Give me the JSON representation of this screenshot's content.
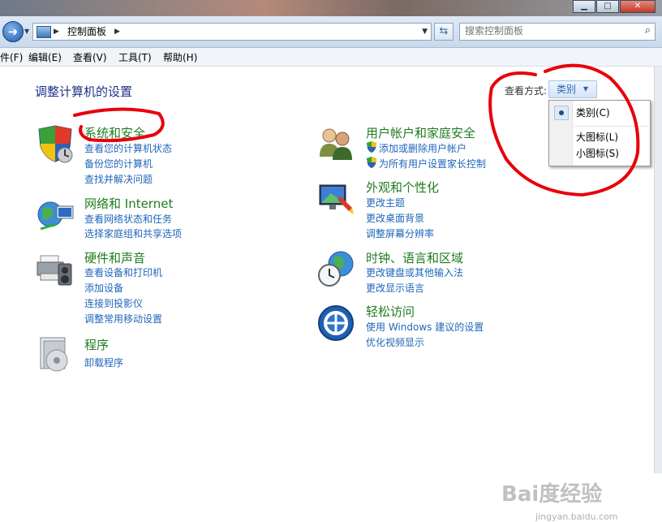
{
  "toolbar": {
    "breadcrumb": "控制面板",
    "search_placeholder": "搜索控制面板"
  },
  "menu": [
    "件(F)",
    "编辑(E)",
    "查看(V)",
    "工具(T)",
    "帮助(H)"
  ],
  "main": {
    "title": "调整计算机的设置",
    "view_label": "查看方式:",
    "view_value": "类别",
    "view_options": [
      "类别(C)",
      "大图标(L)",
      "小图标(S)"
    ],
    "selected_view_option": 0
  },
  "categories": [
    {
      "title": "系统和安全",
      "icon": "shield-security-icon",
      "links": [
        {
          "text": "查看您的计算机状态",
          "shield": false
        },
        {
          "text": "备份您的计算机",
          "shield": false
        },
        {
          "text": "查找并解决问题",
          "shield": false
        }
      ]
    },
    {
      "title": "网络和 Internet",
      "icon": "network-globe-icon",
      "links": [
        {
          "text": "查看网络状态和任务",
          "shield": false
        },
        {
          "text": "选择家庭组和共享选项",
          "shield": false
        }
      ]
    },
    {
      "title": "硬件和声音",
      "icon": "printer-hardware-icon",
      "links": [
        {
          "text": "查看设备和打印机",
          "shield": false
        },
        {
          "text": "添加设备",
          "shield": false
        },
        {
          "text": "连接到投影仪",
          "shield": false
        },
        {
          "text": "调整常用移动设置",
          "shield": false
        }
      ]
    },
    {
      "title": "程序",
      "icon": "programs-disc-icon",
      "links": [
        {
          "text": "卸载程序",
          "shield": false
        }
      ]
    },
    {
      "title": "用户帐户和家庭安全",
      "icon": "users-icon",
      "links": [
        {
          "text": "添加或删除用户帐户",
          "shield": true
        },
        {
          "text": "为所有用户设置家长控制",
          "shield": true
        }
      ]
    },
    {
      "title": "外观和个性化",
      "icon": "appearance-monitor-icon",
      "links": [
        {
          "text": "更改主题",
          "shield": false
        },
        {
          "text": "更改桌面背景",
          "shield": false
        },
        {
          "text": "调整屏幕分辨率",
          "shield": false
        }
      ]
    },
    {
      "title": "时钟、语言和区域",
      "icon": "clock-globe-icon",
      "links": [
        {
          "text": "更改键盘或其他输入法",
          "shield": false
        },
        {
          "text": "更改显示语言",
          "shield": false
        }
      ]
    },
    {
      "title": "轻松访问",
      "icon": "ease-of-access-icon",
      "links": [
        {
          "text": "使用 Windows 建议的设置",
          "shield": false
        },
        {
          "text": "优化视频显示",
          "shield": false
        }
      ]
    }
  ],
  "watermark": {
    "logo": "Bai度经验",
    "url": "jingyan.baidu.com"
  },
  "colors": {
    "category_title": "#1e7c1e",
    "link": "#1e66b8",
    "page_title": "#1e3287",
    "annotation": "#e8000b"
  }
}
